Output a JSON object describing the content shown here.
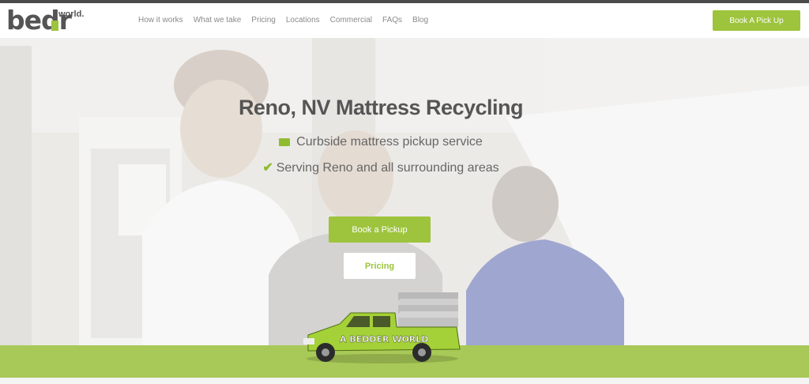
{
  "brand": {
    "logo_main": "bed",
    "logo_r": "r",
    "logo_sub": "world."
  },
  "nav": [
    "How it works",
    "What we take",
    "Pricing",
    "Locations",
    "Commercial",
    "FAQs",
    "Blog"
  ],
  "header_cta": "Book A Pick Up",
  "hero": {
    "title": "Reno, NV Mattress Recycling",
    "lines": [
      "Curbside mattress pickup service",
      "Serving Reno and all surrounding areas"
    ],
    "primary_button": "Book a Pickup",
    "secondary_button": "Pricing"
  },
  "truck_label": "A BEDDER WORLD",
  "colors": {
    "accent": "#9dc43c",
    "text": "#555555",
    "nav": "#8a8a8a"
  },
  "icons": {
    "line1": "truck-icon",
    "line2": "check-icon"
  }
}
